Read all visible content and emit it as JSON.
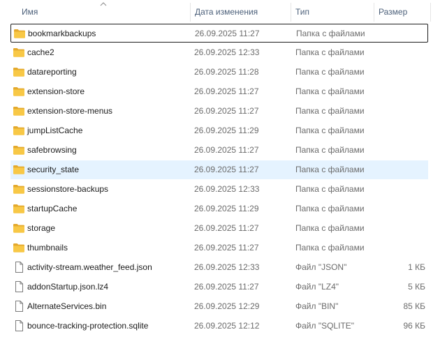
{
  "columns": {
    "name": "Имя",
    "date": "Дата изменения",
    "type": "Тип",
    "size": "Размер"
  },
  "sort_indicator": "chevron-up-icon",
  "colors": {
    "header_text": "#4c607a",
    "folder": "#f8c846",
    "hover_row": "#e5f3ff",
    "selected_border": "#1e1e1e"
  },
  "rows": [
    {
      "name": "bookmarkbackups",
      "date": "26.09.2025 11:27",
      "type": "Папка с файлами",
      "size": "",
      "icon": "folder-icon"
    },
    {
      "name": "cache2",
      "date": "26.09.2025 12:33",
      "type": "Папка с файлами",
      "size": "",
      "icon": "folder-icon"
    },
    {
      "name": "datareporting",
      "date": "26.09.2025 11:28",
      "type": "Папка с файлами",
      "size": "",
      "icon": "folder-icon"
    },
    {
      "name": "extension-store",
      "date": "26.09.2025 11:27",
      "type": "Папка с файлами",
      "size": "",
      "icon": "folder-icon"
    },
    {
      "name": "extension-store-menus",
      "date": "26.09.2025 11:27",
      "type": "Папка с файлами",
      "size": "",
      "icon": "folder-icon"
    },
    {
      "name": "jumpListCache",
      "date": "26.09.2025 11:29",
      "type": "Папка с файлами",
      "size": "",
      "icon": "folder-icon"
    },
    {
      "name": "safebrowsing",
      "date": "26.09.2025 11:27",
      "type": "Папка с файлами",
      "size": "",
      "icon": "folder-icon"
    },
    {
      "name": "security_state",
      "date": "26.09.2025 11:27",
      "type": "Папка с файлами",
      "size": "",
      "icon": "folder-icon"
    },
    {
      "name": "sessionstore-backups",
      "date": "26.09.2025 12:33",
      "type": "Папка с файлами",
      "size": "",
      "icon": "folder-icon"
    },
    {
      "name": "startupCache",
      "date": "26.09.2025 11:29",
      "type": "Папка с файлами",
      "size": "",
      "icon": "folder-icon"
    },
    {
      "name": "storage",
      "date": "26.09.2025 11:27",
      "type": "Папка с файлами",
      "size": "",
      "icon": "folder-icon"
    },
    {
      "name": "thumbnails",
      "date": "26.09.2025 11:27",
      "type": "Папка с файлами",
      "size": "",
      "icon": "folder-icon"
    },
    {
      "name": "activity-stream.weather_feed.json",
      "date": "26.09.2025 12:33",
      "type": "Файл \"JSON\"",
      "size": "1 КБ",
      "icon": "file-icon"
    },
    {
      "name": "addonStartup.json.lz4",
      "date": "26.09.2025 11:27",
      "type": "Файл \"LZ4\"",
      "size": "5 КБ",
      "icon": "file-icon"
    },
    {
      "name": "AlternateServices.bin",
      "date": "26.09.2025 12:29",
      "type": "Файл \"BIN\"",
      "size": "85 КБ",
      "icon": "file-icon"
    },
    {
      "name": "bounce-tracking-protection.sqlite",
      "date": "26.09.2025 12:12",
      "type": "Файл \"SQLITE\"",
      "size": "96 КБ",
      "icon": "file-icon"
    }
  ]
}
